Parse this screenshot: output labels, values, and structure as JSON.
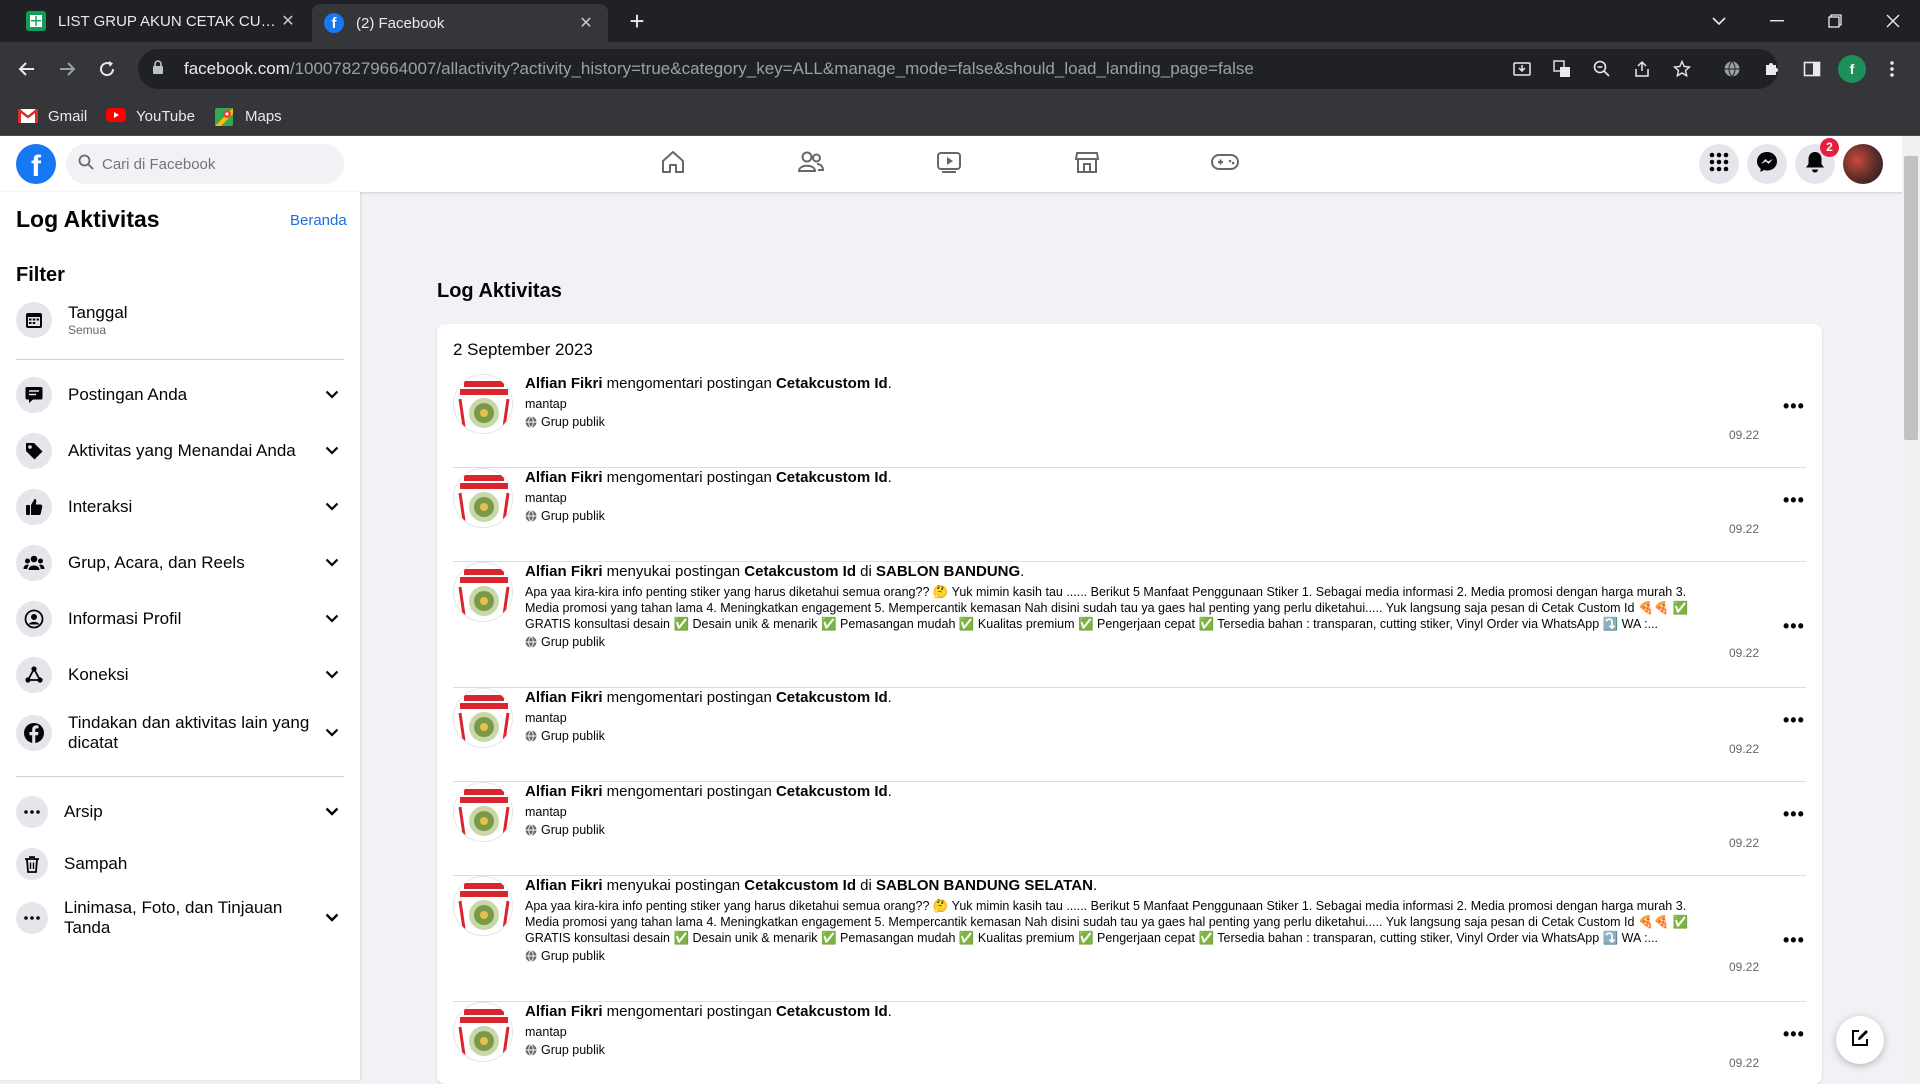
{
  "browser": {
    "tabs": [
      {
        "title": "LIST GRUP AKUN CETAK CUSTOM",
        "close": "✕"
      },
      {
        "title": "(2) Facebook",
        "close": "✕"
      }
    ],
    "new_tab": "+",
    "url_domain": "facebook.com",
    "url_path": "/100078279664007/allactivity?activity_history=true&category_key=ALL&manage_mode=false&should_load_landing_page=false",
    "profile_initial": "f",
    "bookmarks": [
      "Gmail",
      "YouTube",
      "Maps"
    ]
  },
  "fb": {
    "search_placeholder": "Cari di Facebook",
    "notification_count": "2"
  },
  "sidebar": {
    "title": "Log Aktivitas",
    "home_link": "Beranda",
    "filter_heading": "Filter",
    "date_filter": {
      "label": "Tanggal",
      "sub": "Semua"
    },
    "categories": [
      {
        "label": "Postingan Anda"
      },
      {
        "label": "Aktivitas yang Menandai Anda"
      },
      {
        "label": "Interaksi"
      },
      {
        "label": "Grup, Acara, dan Reels"
      },
      {
        "label": "Informasi Profil"
      },
      {
        "label": "Koneksi"
      },
      {
        "label": "Tindakan dan aktivitas lain yang dicatat"
      }
    ],
    "extras": [
      {
        "label": "Arsip"
      },
      {
        "label": "Sampah"
      },
      {
        "label": "Linimasa, Foto, dan Tinjauan Tanda"
      }
    ]
  },
  "main": {
    "title": "Log Aktivitas",
    "date": "2 September 2023",
    "entries": [
      {
        "actor": "Alfian Fikri",
        "verb": " mengomentari postingan ",
        "target": "Cetakcustom Id",
        "where_prefix": "",
        "where": "",
        "end": ".",
        "text1": "mantap",
        "text2": "",
        "text3": "",
        "privacy": "Grup publik",
        "time": "09.22"
      },
      {
        "actor": "Alfian Fikri",
        "verb": " mengomentari postingan ",
        "target": "Cetakcustom Id",
        "where_prefix": "",
        "where": "",
        "end": ".",
        "text1": "mantap",
        "text2": "",
        "text3": "",
        "privacy": "Grup publik",
        "time": "09.22"
      },
      {
        "actor": "Alfian Fikri",
        "verb": " menyukai postingan ",
        "target": "Cetakcustom Id",
        "where_prefix": " di ",
        "where": "SABLON BANDUNG",
        "end": ".",
        "text1": "Apa yaa kira-kira info penting stiker yang harus diketahui semua orang?? 🤔 Yuk mimin kasih tau ...... Berikut 5 Manfaat Penggunaan Stiker 1. Sebagai media informasi 2. Media promosi dengan harga murah 3.",
        "text2": "Media promosi yang tahan lama 4. Meningkatkan engagement 5. Mempercantik kemasan Nah disini sudah tau ya gaes hal penting yang perlu diketahui..... Yuk langsung saja pesan di Cetak Custom Id 🍕🍕 ✅",
        "text3": "GRATIS konsultasi desain ✅ Desain unik & menarik ✅ Pemasangan mudah ✅ Kualitas premium ✅ Pengerjaan cepat ✅ Tersedia bahan : transparan, cutting stiker, Vinyl Order via WhatsApp ⤵️ WA :...",
        "privacy": "Grup publik",
        "time": "09.22"
      },
      {
        "actor": "Alfian Fikri",
        "verb": " mengomentari postingan ",
        "target": "Cetakcustom Id",
        "where_prefix": "",
        "where": "",
        "end": ".",
        "text1": "mantap",
        "text2": "",
        "text3": "",
        "privacy": "Grup publik",
        "time": "09.22"
      },
      {
        "actor": "Alfian Fikri",
        "verb": " mengomentari postingan ",
        "target": "Cetakcustom Id",
        "where_prefix": "",
        "where": "",
        "end": ".",
        "text1": "mantap",
        "text2": "",
        "text3": "",
        "privacy": "Grup publik",
        "time": "09.22"
      },
      {
        "actor": "Alfian Fikri",
        "verb": " menyukai postingan ",
        "target": "Cetakcustom Id",
        "where_prefix": " di ",
        "where": "SABLON BANDUNG SELATAN",
        "end": ".",
        "text1": "Apa yaa kira-kira info penting stiker yang harus diketahui semua orang?? 🤔 Yuk mimin kasih tau ...... Berikut 5 Manfaat Penggunaan Stiker 1. Sebagai media informasi 2. Media promosi dengan harga murah 3.",
        "text2": "Media promosi yang tahan lama 4. Meningkatkan engagement 5. Mempercantik kemasan Nah disini sudah tau ya gaes hal penting yang perlu diketahui..... Yuk langsung saja pesan di Cetak Custom Id 🍕🍕 ✅",
        "text3": "GRATIS konsultasi desain ✅ Desain unik & menarik ✅ Pemasangan mudah ✅ Kualitas premium ✅ Pengerjaan cepat ✅ Tersedia bahan : transparan, cutting stiker, Vinyl Order via WhatsApp ⤵️ WA :...",
        "privacy": "Grup publik",
        "time": "09.22"
      },
      {
        "actor": "Alfian Fikri",
        "verb": " mengomentari postingan ",
        "target": "Cetakcustom Id",
        "where_prefix": "",
        "where": "",
        "end": ".",
        "text1": "mantap",
        "text2": "",
        "text3": "",
        "privacy": "Grup publik",
        "time": "09.22"
      }
    ],
    "more_glyph": "•••"
  },
  "colors": {
    "fb_blue": "#1877f2",
    "link_blue": "#216fdb",
    "badge_red": "#e41e3f"
  }
}
